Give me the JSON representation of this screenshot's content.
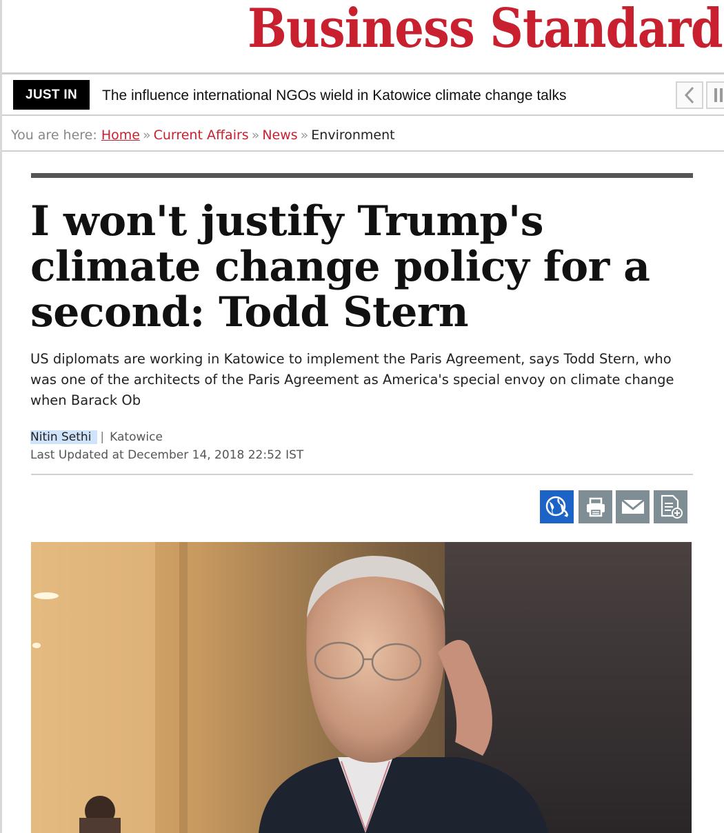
{
  "masthead": {
    "logo_text": "Business Standard",
    "brand_color": "#c8202f"
  },
  "just_in": {
    "label": "JUST IN",
    "headline": "The influence international NGOs wield in Katowice climate change talks"
  },
  "breadcrumb": {
    "prefix": "You are here:",
    "items": [
      "Home",
      "Current Affairs",
      "News"
    ],
    "current": "Environment",
    "separator": "»"
  },
  "article": {
    "title": "I won't justify Trump's climate change policy for a second: Todd Stern",
    "summary": "US diplomats are working in Katowice to implement the Paris Agreement, says Todd Stern, who was one of the architects of the Paris Agreement as America's special envoy on climate change when Barack Ob",
    "author": "Nitin Sethi",
    "byline_separator": "|",
    "location": "Katowice",
    "updated": "Last Updated at December 14, 2018 22:52 IST"
  },
  "share_icons": [
    "globe-share-icon",
    "print-icon",
    "email-icon",
    "add-document-icon"
  ],
  "colors": {
    "globe_button": "#1b63c6",
    "share_buttons": "#7f8d94"
  }
}
